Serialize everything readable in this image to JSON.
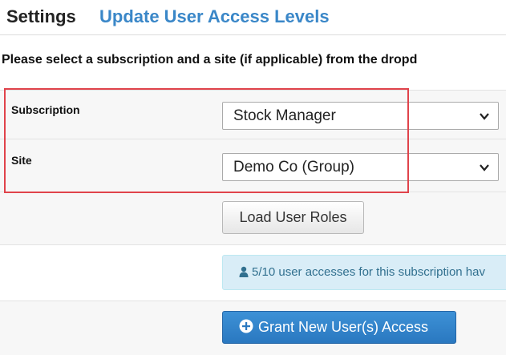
{
  "header": {
    "title": "Settings",
    "subtitle": "Update User Access Levels"
  },
  "instruction": "Please select a subscription and a site (if applicable) from the dropd",
  "form": {
    "subscription_label": "Subscription",
    "subscription_value": "Stock Manager",
    "site_label": "Site",
    "site_value": "Demo Co (Group)"
  },
  "buttons": {
    "load_roles": "Load User Roles",
    "grant_access": "Grant New User(s) Access"
  },
  "info": {
    "text": "5/10 user accesses for this subscription hav",
    "icon": "user-icon"
  },
  "colors": {
    "accent": "#3a87c8",
    "highlight": "#e0434b",
    "info_bg": "#d9edf7",
    "primary_button": "#2a78c0"
  }
}
